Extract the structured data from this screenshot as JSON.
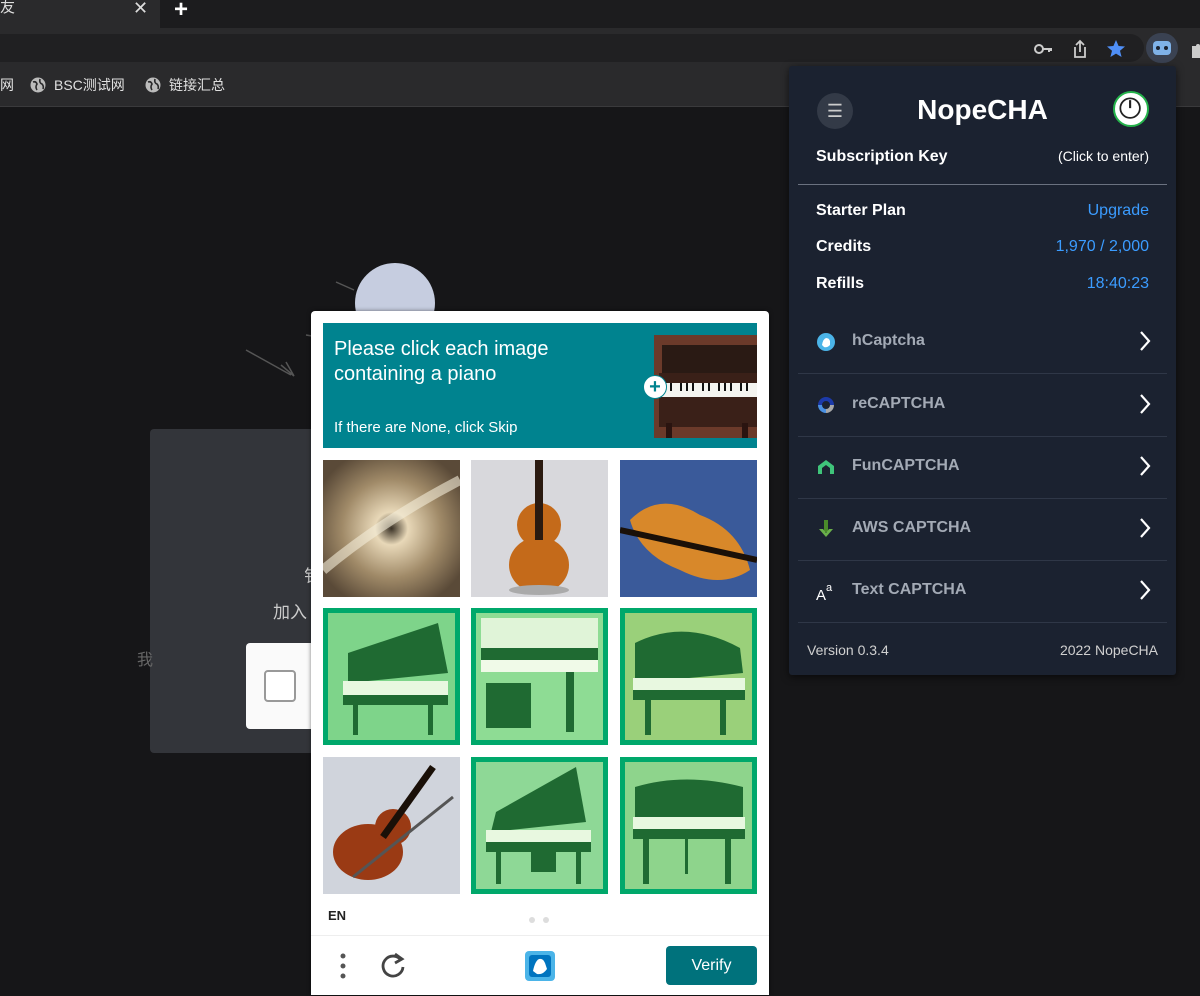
{
  "browser": {
    "tab_title": "友",
    "tab_close": "✕",
    "new_tab": "+",
    "bookmarks": [
      {
        "label": "网"
      },
      {
        "label": "BSC测试网"
      },
      {
        "label": "链接汇总"
      }
    ]
  },
  "page": {
    "char1": "钅",
    "char2": "加入",
    "char3": "我"
  },
  "hcaptcha": {
    "prompt": "Please click each image containing a piano",
    "subprompt": "If there are None, click Skip",
    "language": "EN",
    "verify_label": "Verify",
    "tiles": [
      {
        "subject": "cymbal",
        "selected": false
      },
      {
        "subject": "violin",
        "selected": false
      },
      {
        "subject": "violin",
        "selected": false
      },
      {
        "subject": "piano",
        "selected": true
      },
      {
        "subject": "piano",
        "selected": true
      },
      {
        "subject": "piano",
        "selected": true
      },
      {
        "subject": "violin",
        "selected": false
      },
      {
        "subject": "piano",
        "selected": true
      },
      {
        "subject": "piano",
        "selected": true
      }
    ]
  },
  "nopecha": {
    "title": "NopeCHA",
    "subscription_label": "Subscription Key",
    "subscription_value": "(Click to enter)",
    "plan_label": "Starter Plan",
    "plan_action": "Upgrade",
    "credits_label": "Credits",
    "credits_value": "1,970 / 2,000",
    "refills_label": "Refills",
    "refills_value": "18:40:23",
    "items": [
      {
        "label": "hCaptcha",
        "icon": "hcaptcha-icon"
      },
      {
        "label": "reCAPTCHA",
        "icon": "recaptcha-icon"
      },
      {
        "label": "FunCAPTCHA",
        "icon": "funcaptcha-icon"
      },
      {
        "label": "AWS CAPTCHA",
        "icon": "aws-icon"
      },
      {
        "label": "Text CAPTCHA",
        "icon": "text-captcha-icon"
      }
    ],
    "version": "Version 0.3.4",
    "copyright": "2022 NopeCHA",
    "accent_color": "#3b9cff"
  }
}
